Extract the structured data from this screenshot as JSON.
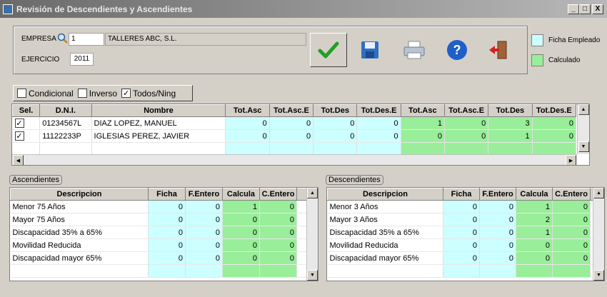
{
  "window": {
    "title": "Revisión de Descendientes y Ascendientes",
    "min": "_",
    "max": "□",
    "close": "X"
  },
  "header": {
    "empresa_label": "EMPRESA",
    "empresa_code": "1",
    "empresa_name": "TALLERES ABC, S.L.",
    "ejercicio_label": "EJERCICIO",
    "ejercicio_value": "2011"
  },
  "legend": {
    "ficha": "Ficha Empleado",
    "calculado": "Calculado",
    "ficha_color": "#ccffff",
    "calculado_color": "#99ee99"
  },
  "filters": {
    "condicional": "Condicional",
    "inverso": "Inverso",
    "todos": "Todos/Ning"
  },
  "main_table": {
    "headers": [
      "Sel.",
      "D.N.I.",
      "Nombre",
      "Tot.Asc",
      "Tot.Asc.E",
      "Tot.Des",
      "Tot.Des.E",
      "Tot.Asc",
      "Tot.Asc.E",
      "Tot.Des",
      "Tot.Des.E"
    ],
    "rows": [
      {
        "dni": "01234567L",
        "nombre": "DIAZ  LOPEZ, MANUEL",
        "v": [
          "0",
          "0",
          "0",
          "0",
          "1",
          "0",
          "3",
          "0"
        ]
      },
      {
        "dni": "11122233P",
        "nombre": "IGLESIAS PEREZ, JAVIER",
        "v": [
          "0",
          "0",
          "0",
          "0",
          "0",
          "0",
          "1",
          "0"
        ]
      }
    ]
  },
  "asc": {
    "title": "Ascendientes",
    "headers": [
      "Descripcion",
      "Ficha",
      "F.Entero",
      "Calcula",
      "C.Entero"
    ],
    "rows": [
      {
        "d": "Menor 75 Años",
        "v": [
          "0",
          "0",
          "1",
          "0"
        ]
      },
      {
        "d": "Mayor 75 Años",
        "v": [
          "0",
          "0",
          "0",
          "0"
        ]
      },
      {
        "d": "Discapacidad 35% a 65%",
        "v": [
          "0",
          "0",
          "0",
          "0"
        ]
      },
      {
        "d": "Movilidad Reducida",
        "v": [
          "0",
          "0",
          "0",
          "0"
        ]
      },
      {
        "d": "Discapacidad mayor 65%",
        "v": [
          "0",
          "0",
          "0",
          "0"
        ]
      }
    ]
  },
  "des": {
    "title": "Descendientes",
    "headers": [
      "Descripcion",
      "Ficha",
      "F.Entero",
      "Calcula",
      "C.Entero"
    ],
    "rows": [
      {
        "d": "Menor 3 Años",
        "v": [
          "0",
          "0",
          "1",
          "0"
        ]
      },
      {
        "d": "Mayor 3 Años",
        "v": [
          "0",
          "0",
          "2",
          "0"
        ]
      },
      {
        "d": "Discapacidad 35% a 65%",
        "v": [
          "0",
          "0",
          "1",
          "0"
        ]
      },
      {
        "d": "Movilidad Reducida",
        "v": [
          "0",
          "0",
          "0",
          "0"
        ]
      },
      {
        "d": "Discapacidad mayor 65%",
        "v": [
          "0",
          "0",
          "0",
          "0"
        ]
      }
    ]
  }
}
